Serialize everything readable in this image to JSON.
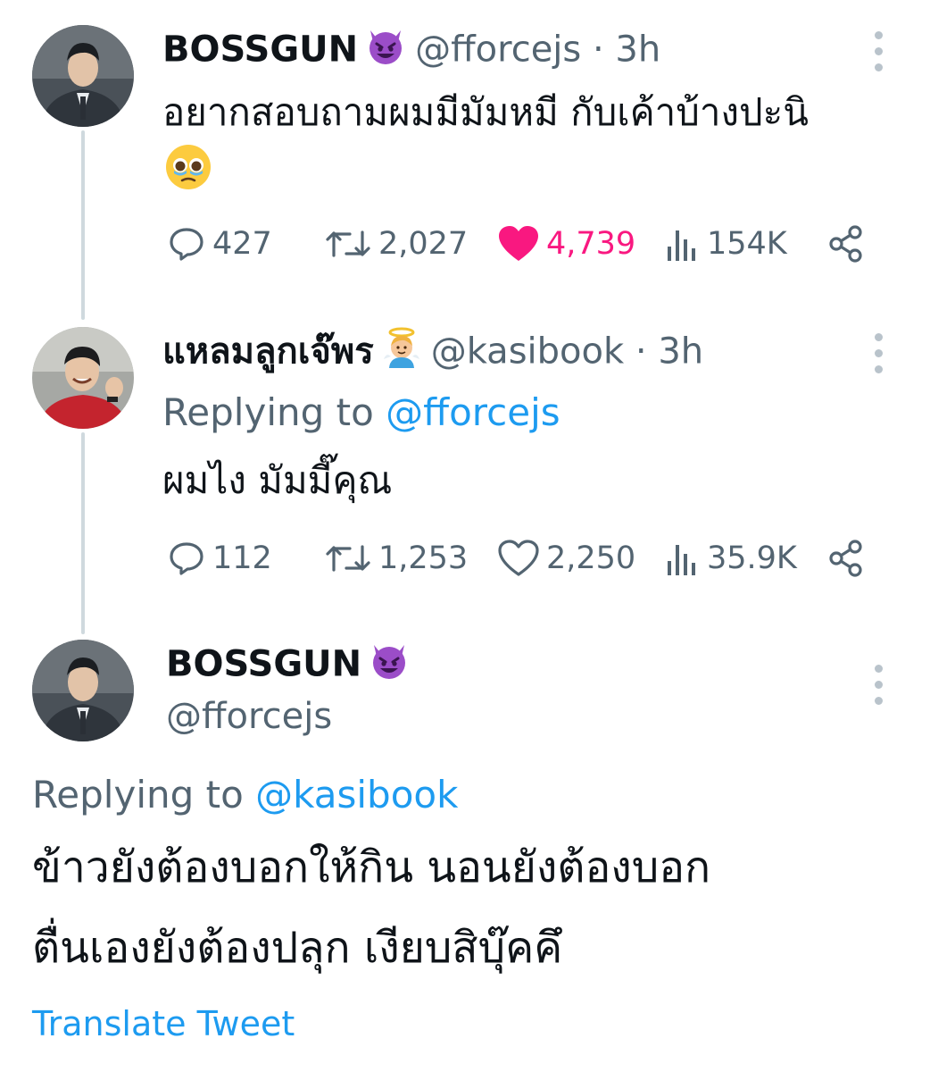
{
  "thread_line_color": "#cfd9de",
  "accent_blue": "#1d9bf0",
  "like_pink": "#f91880",
  "tweets": [
    {
      "name": "BOSSGUN",
      "handle": "@fforcejs",
      "separator": "·",
      "time": "3h",
      "name_emoji": "smiling-face-with-horns",
      "text": "อยากสอบถามผมมีมัมหมี กับเค้าบ้างปะนิ",
      "text_emoji": "pleading-tear-face",
      "stats": {
        "replies": "427",
        "retweets": "2,027",
        "likes": "4,739",
        "views": "154K",
        "liked": true
      }
    },
    {
      "name": "แหลมลูกเจ๊พร",
      "handle": "@kasibook",
      "separator": "·",
      "time": "3h",
      "name_emoji": "baby-angel",
      "replying_label": "Replying to",
      "replying_handle": "@fforcejs",
      "text": "ผมไง มัมมี๊คุณ",
      "stats": {
        "replies": "112",
        "retweets": "1,253",
        "likes": "2,250",
        "views": "35.9K",
        "liked": false
      }
    },
    {
      "name": "BOSSGUN",
      "handle": "@fforcejs",
      "name_emoji": "smiling-face-with-horns",
      "replying_label": "Replying to",
      "replying_handle": "@kasibook",
      "text_line1": "ข้าวยังต้องบอกให้กิน นอนยังต้องบอก",
      "text_line2": "ตื่นเองยังต้องปลุก เงียบสิบุ๊คคึ"
    }
  ],
  "translate_label": "Translate Tweet"
}
